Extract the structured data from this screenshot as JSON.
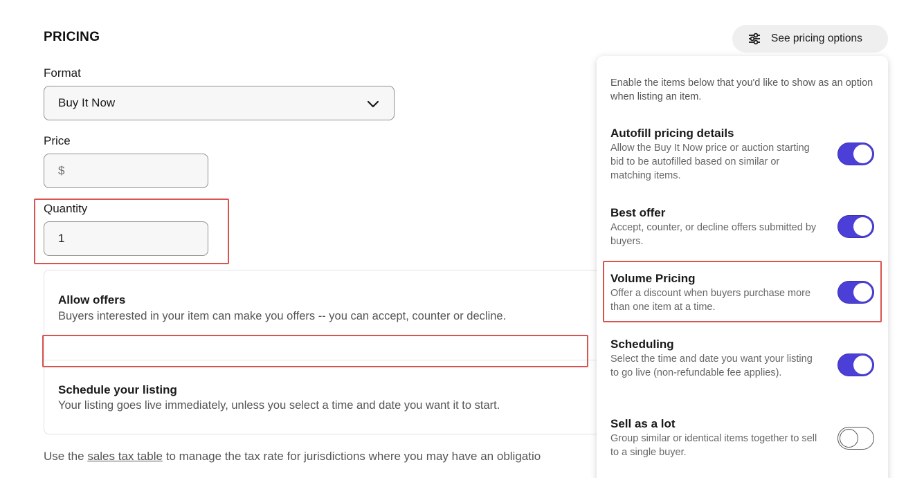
{
  "section": {
    "title": "PRICING"
  },
  "format": {
    "label": "Format",
    "value": "Buy It Now",
    "icon": "chevron-down-icon"
  },
  "price": {
    "label": "Price",
    "placeholder": "$"
  },
  "quantity": {
    "label": "Quantity",
    "value": "1"
  },
  "card": {
    "allow_offers": {
      "title": "Allow offers",
      "desc": "Buyers interested in your item can make you offers -- you can accept, counter or decline."
    },
    "schedule": {
      "title": "Schedule your listing",
      "desc": "Your listing goes live immediately, unless you select a time and date you want it to start."
    }
  },
  "footer": {
    "prefix": "Use the ",
    "link": "sales tax table",
    "suffix": " to manage the tax rate for jurisdictions where you may have an obligatio"
  },
  "pricing_options_button": {
    "label": "See pricing options",
    "icon": "sliders-icon"
  },
  "panel": {
    "intro": "Enable the items below that you'd like to show as an option when listing an item.",
    "options": [
      {
        "title": "Autofill pricing details",
        "desc": "Allow the Buy It Now price or auction starting bid to be autofilled based on similar or matching items.",
        "enabled": true
      },
      {
        "title": "Best offer",
        "desc": "Accept, counter, or decline offers submitted by buyers.",
        "enabled": true
      },
      {
        "title": "Volume Pricing",
        "desc": "Offer a discount when buyers purchase more than one item at a time.",
        "enabled": true
      },
      {
        "title": "Scheduling",
        "desc": "Select the time and date you want your listing to go live (non-refundable fee applies).",
        "enabled": true
      },
      {
        "title": "Sell as a lot",
        "desc": "Group similar or identical items together to sell to a single buyer.",
        "enabled": false
      }
    ]
  },
  "colors": {
    "toggle_on": "#4c3fd8",
    "highlight": "#d9534f"
  }
}
